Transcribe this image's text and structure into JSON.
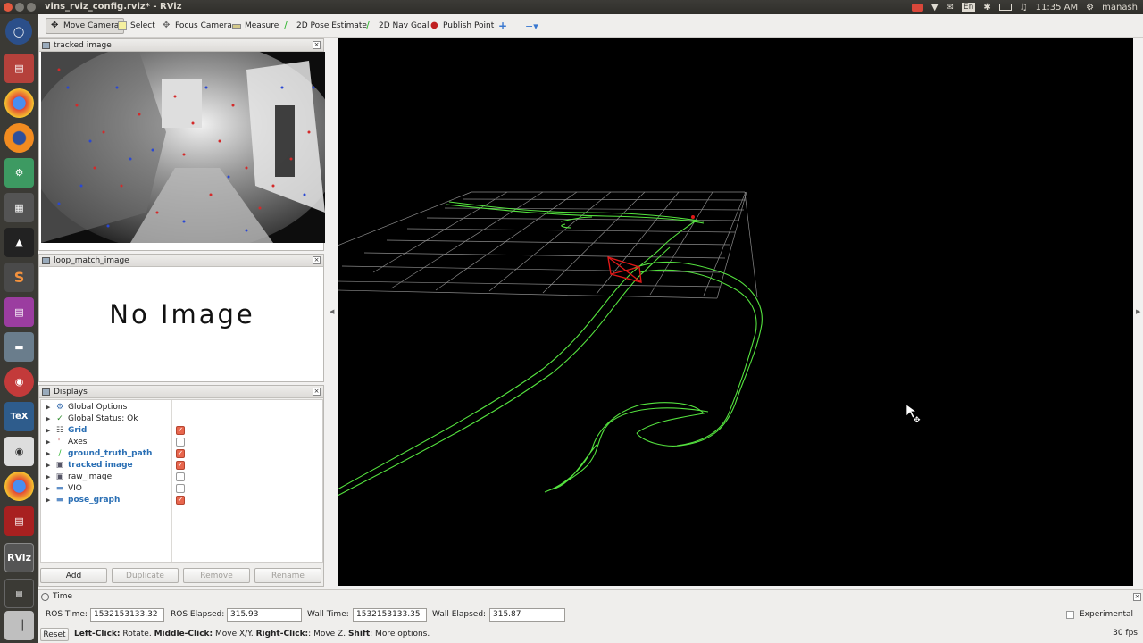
{
  "window": {
    "title": "vins_rviz_config.rviz* - RViz",
    "clock": "11:35 AM",
    "user": "manash",
    "keyboard": "En"
  },
  "toolbar": {
    "tools": [
      {
        "label": "Move Camera",
        "icon": "move-camera-icon",
        "active": true
      },
      {
        "label": "Select",
        "icon": "select-icon"
      },
      {
        "label": "Focus Camera",
        "icon": "focus-camera-icon"
      },
      {
        "label": "Measure",
        "icon": "measure-icon"
      },
      {
        "label": "2D Pose Estimate",
        "icon": "pose-estimate-icon"
      },
      {
        "label": "2D Nav Goal",
        "icon": "nav-goal-icon"
      },
      {
        "label": "Publish Point",
        "icon": "publish-point-icon"
      }
    ]
  },
  "panels": {
    "tracked_image": {
      "title": "tracked image"
    },
    "loop_match": {
      "title": "loop_match_image",
      "placeholder": "No Image"
    },
    "displays": {
      "title": "Displays",
      "items": [
        {
          "label": "Global Options",
          "icon": "gear-icon",
          "checkbox": null,
          "highlight": false
        },
        {
          "label": "Global Status: Ok",
          "icon": "check-icon",
          "checkbox": null,
          "highlight": false
        },
        {
          "label": "Grid",
          "icon": "grid-icon",
          "checkbox": true,
          "highlight": true
        },
        {
          "label": "Axes",
          "icon": "axes-icon",
          "checkbox": false,
          "highlight": false
        },
        {
          "label": "ground_truth_path",
          "icon": "path-icon",
          "checkbox": true,
          "highlight": true
        },
        {
          "label": "tracked image",
          "icon": "image-icon",
          "checkbox": true,
          "highlight": true
        },
        {
          "label": "raw_image",
          "icon": "image-icon",
          "checkbox": false,
          "highlight": false
        },
        {
          "label": "VIO",
          "icon": "folder-icon",
          "checkbox": false,
          "highlight": false
        },
        {
          "label": "pose_graph",
          "icon": "folder-icon",
          "checkbox": true,
          "highlight": true
        }
      ],
      "buttons": {
        "add": "Add",
        "duplicate": "Duplicate",
        "remove": "Remove",
        "rename": "Rename"
      }
    }
  },
  "time": {
    "title": "Time",
    "ros_time_label": "ROS Time:",
    "ros_time": "1532153133.32",
    "ros_elapsed_label": "ROS Elapsed:",
    "ros_elapsed": "315.93",
    "wall_time_label": "Wall Time:",
    "wall_time": "1532153133.35",
    "wall_elapsed_label": "Wall Elapsed:",
    "wall_elapsed": "315.87",
    "experimental": "Experimental"
  },
  "status": {
    "reset": "Reset",
    "left_click": "Left-Click:",
    "left_text": " Rotate. ",
    "middle_click": "Middle-Click:",
    "middle_text": " Move X/Y. ",
    "right_click": "Right-Click:",
    "right_text": ": Move Z. ",
    "shift": "Shift",
    "shift_text": ": More options.",
    "fps": "30 fps"
  },
  "colors": {
    "path": "#55e33f",
    "camera_marker": "#e01818",
    "grid": "#8a8a8a",
    "checkbox_on": "#e8664d",
    "highlight_text": "#2a6fb4"
  }
}
